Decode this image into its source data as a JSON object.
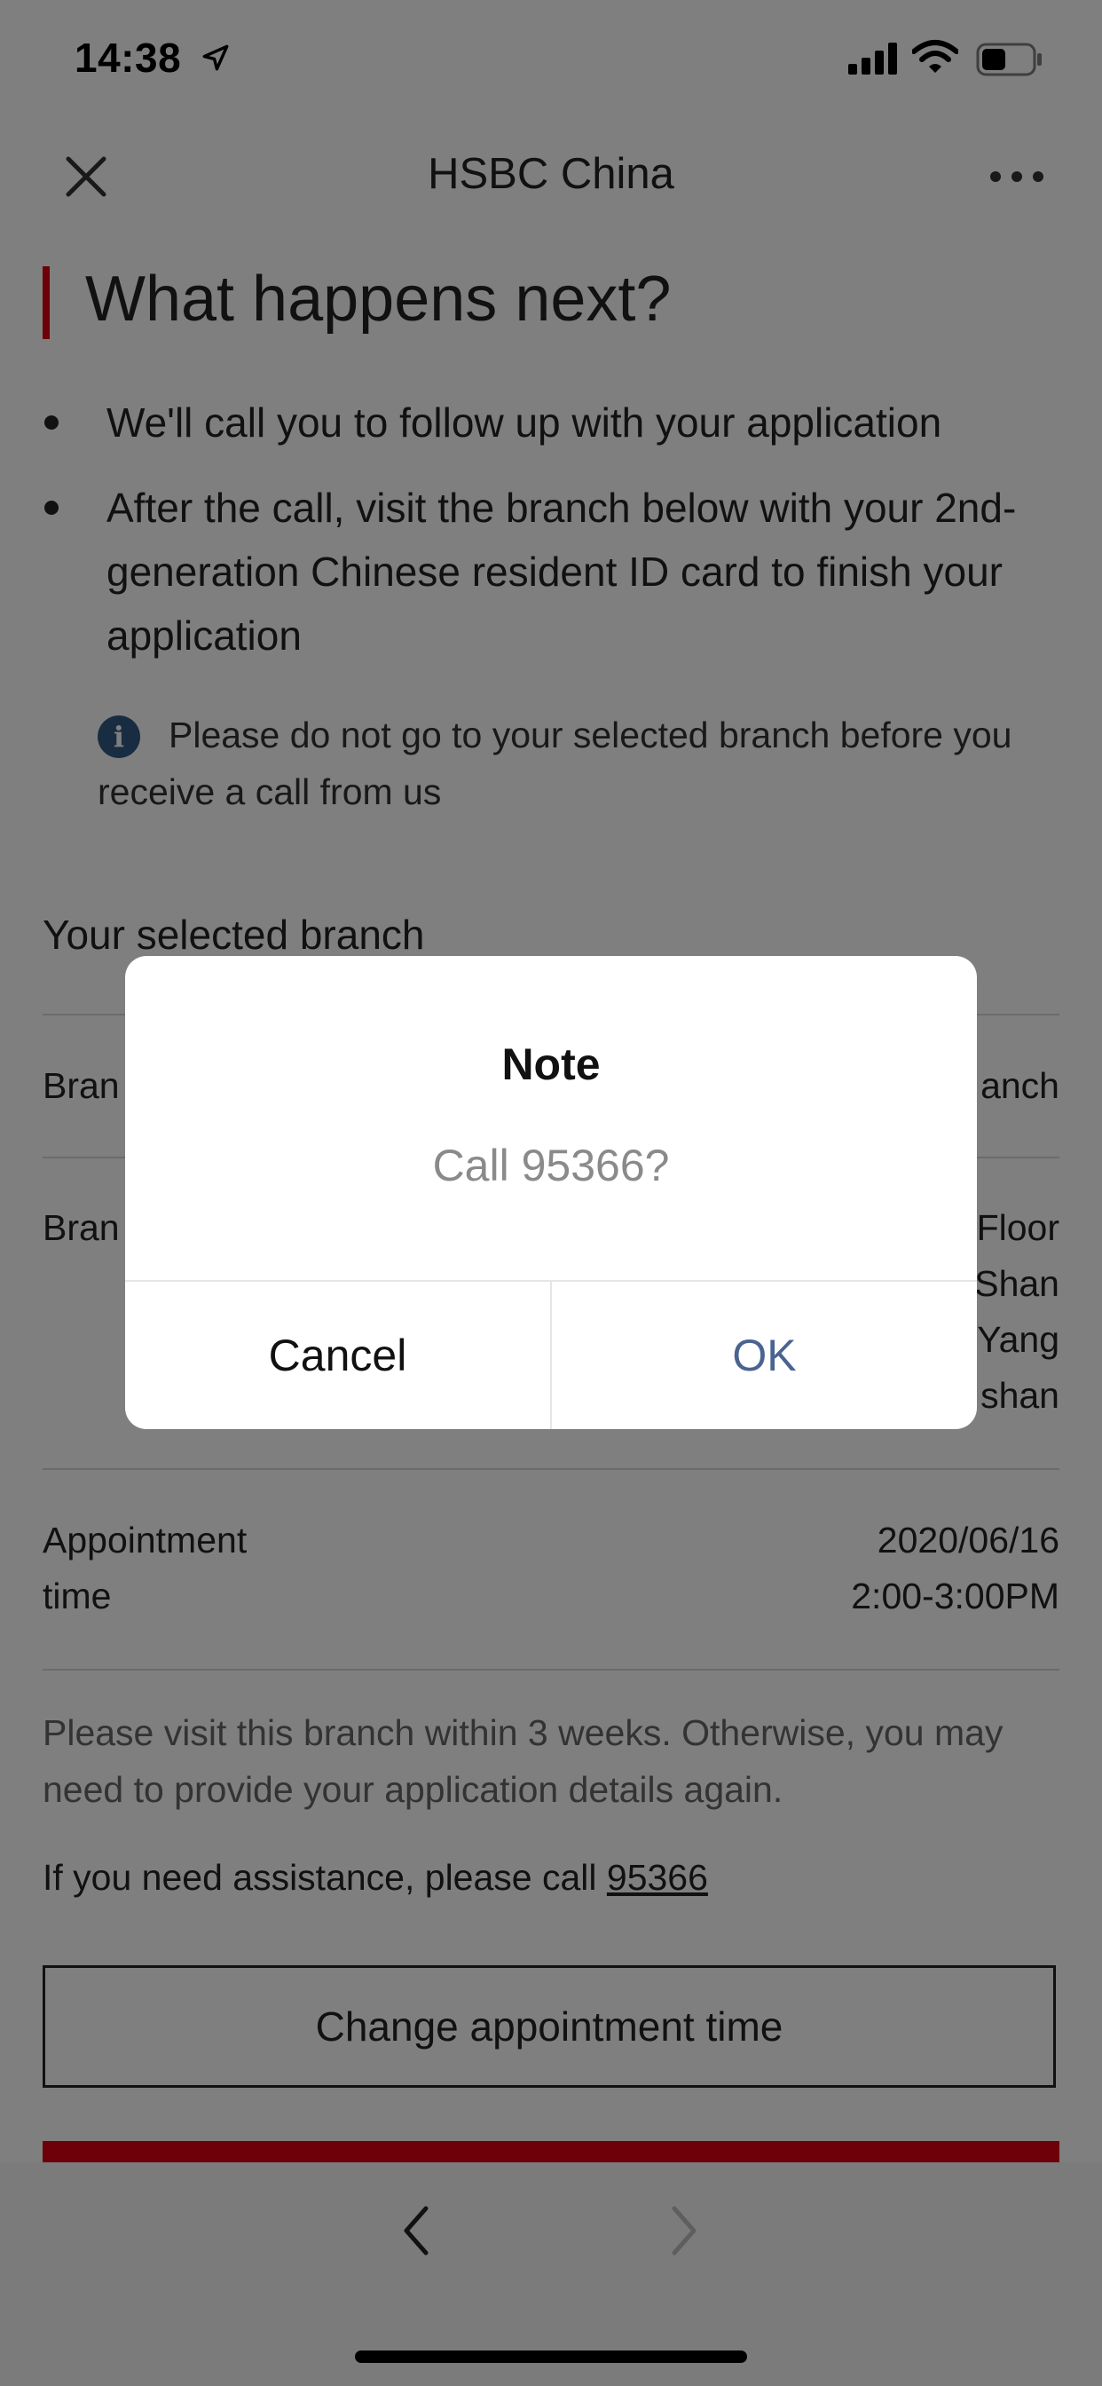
{
  "status_bar": {
    "time": "14:38"
  },
  "nav": {
    "title": "HSBC China"
  },
  "content": {
    "heading": "What happens next?",
    "bullets": [
      "We'll call you to follow up with your application",
      "After the call, visit the branch below with your 2nd-generation Chinese resident ID card to finish your application"
    ],
    "info_notice": "Please do not go to your selected branch before you receive a call from us",
    "section_title": "Your selected branch",
    "branch_name_label": "Bran",
    "branch_name_value": "anch",
    "branch_address_label": "Bran",
    "branch_address_lines": [
      "Floor",
      "Shan",
      "Yang",
      "shan"
    ],
    "appointment_label_line1": "Appointment",
    "appointment_label_line2": "time",
    "appointment_date": "2020/06/16",
    "appointment_time": "2:00-3:00PM",
    "visit_note": "Please visit this branch within 3 weeks. Otherwise, you may need to provide your application details again.",
    "assist_prefix": "If you need assistance, please call ",
    "assist_phone": "95366",
    "change_button": "Change appointment time"
  },
  "dialog": {
    "title": "Note",
    "message": "Call 95366?",
    "cancel": "Cancel",
    "ok": "OK"
  },
  "colors": {
    "brand_red": "#db0011",
    "ok_blue": "#4a6491",
    "info_blue": "#305a85"
  },
  "icons": {
    "close": "close-icon",
    "more": "more-icon",
    "info": "info-icon",
    "back": "chevron-left-icon",
    "forward": "chevron-right-icon"
  }
}
